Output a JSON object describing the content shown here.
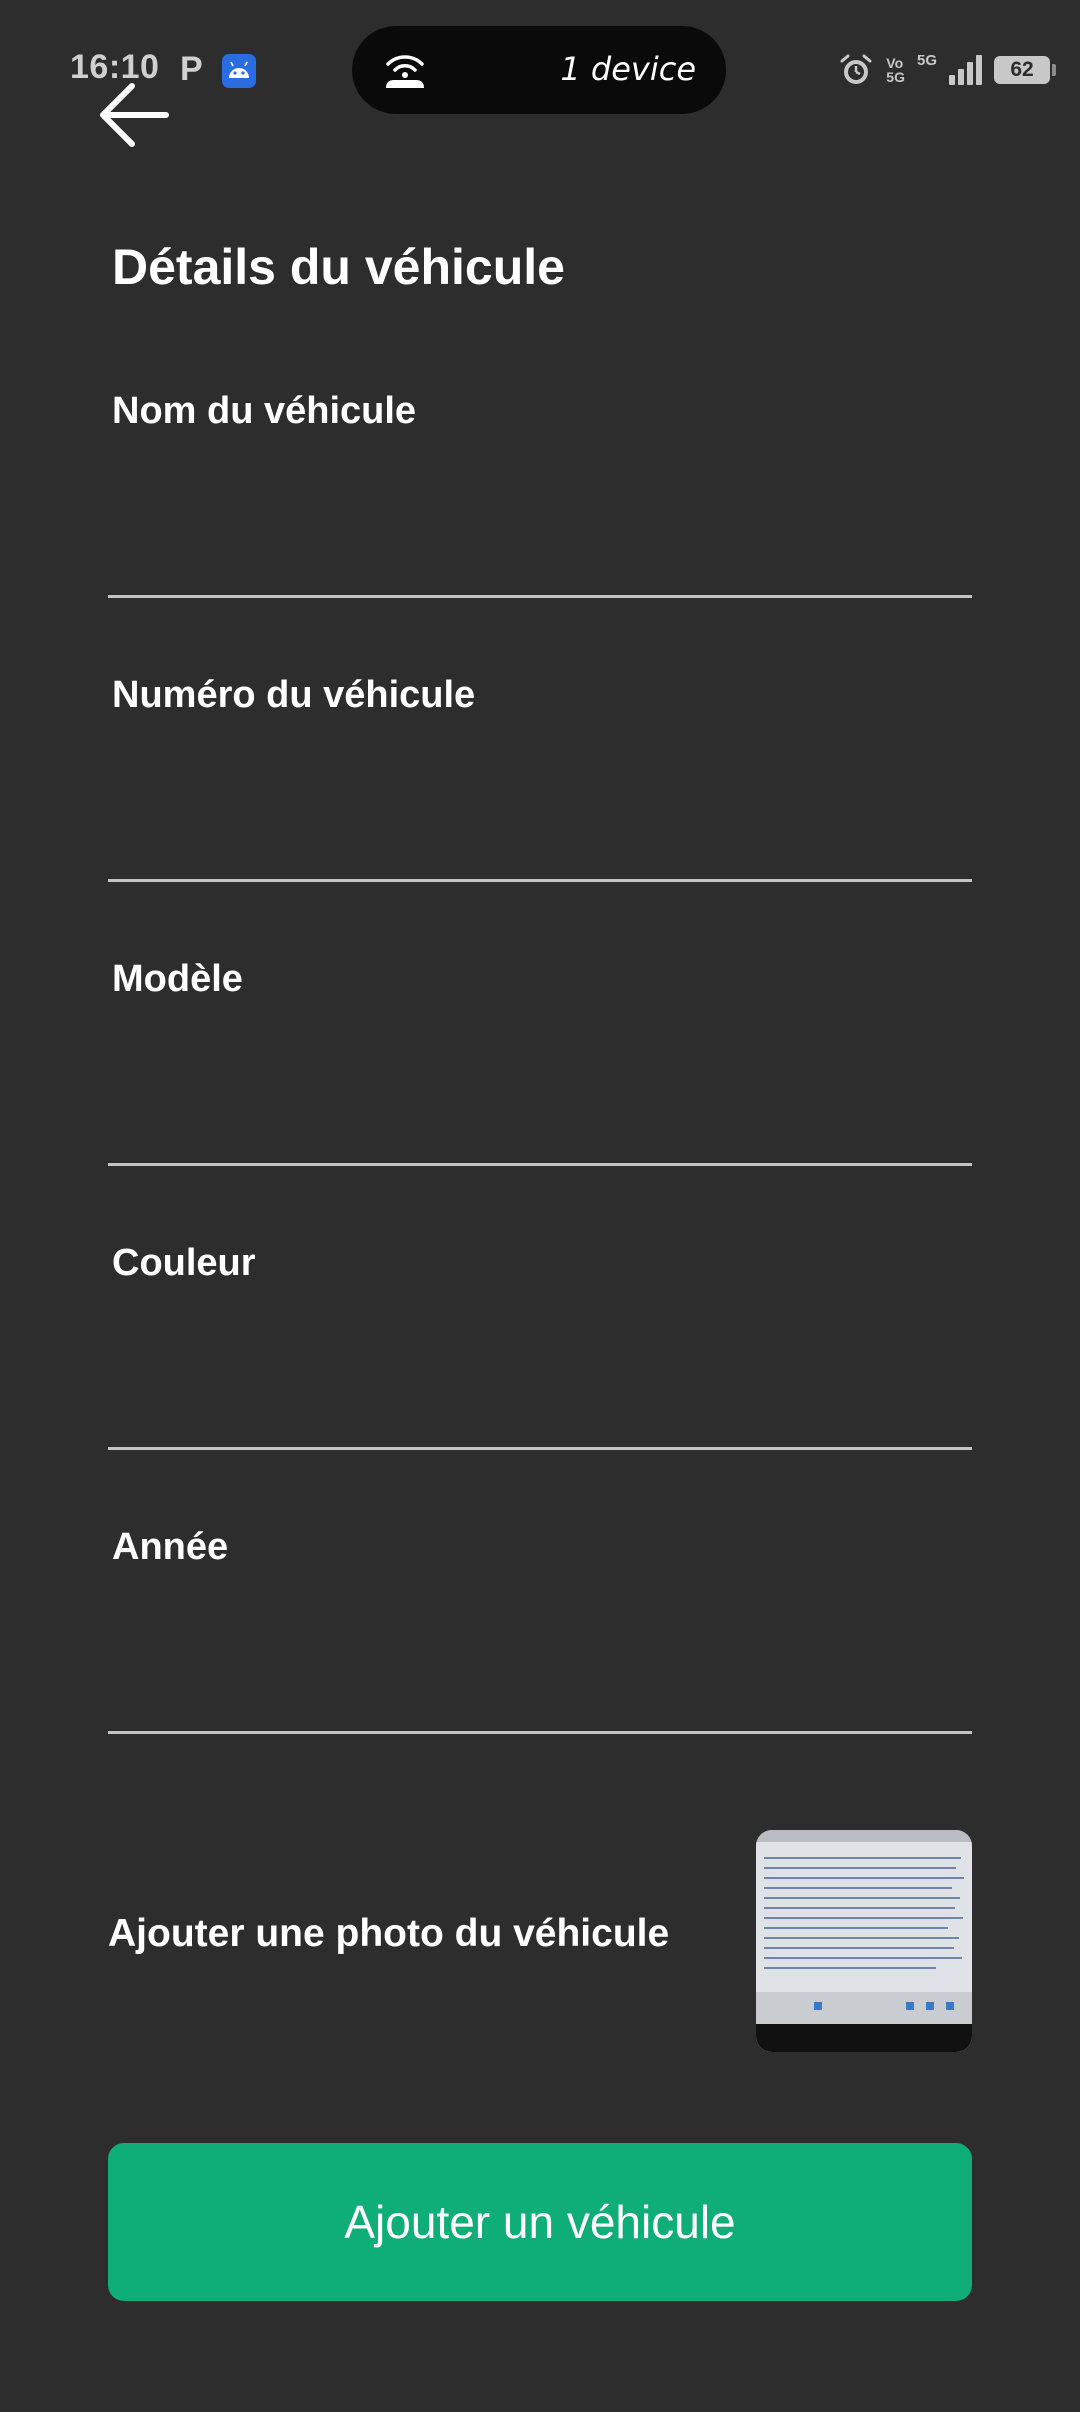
{
  "status_bar": {
    "time": "16:10",
    "notification_letter": "P",
    "island_text": "1 device",
    "volte": "Vo",
    "volte_sub": "5G",
    "network": "5G",
    "battery": "62"
  },
  "header": {
    "back_icon": "arrow-left-icon",
    "title": "Détails du véhicule"
  },
  "form": {
    "fields": [
      {
        "label": "Nom du véhicule",
        "value": ""
      },
      {
        "label": "Numéro du véhicule",
        "value": ""
      },
      {
        "label": "Modèle",
        "value": ""
      },
      {
        "label": "Couleur",
        "value": ""
      },
      {
        "label": "Année",
        "value": ""
      }
    ],
    "photo_label": "Ajouter une photo du véhicule",
    "submit_label": "Ajouter un véhicule"
  },
  "colors": {
    "background": "#2d2d2d",
    "accent": "#0fae79",
    "underline": "#c4c4c4"
  }
}
